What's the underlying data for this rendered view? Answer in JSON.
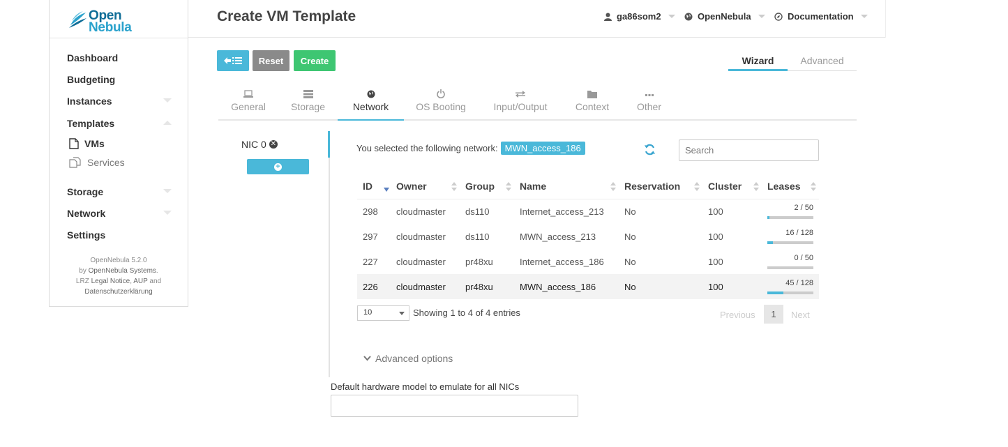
{
  "brand": {
    "line1": "Open",
    "line2": "Nebula"
  },
  "sidebar": {
    "items": [
      {
        "label": "Dashboard"
      },
      {
        "label": "Budgeting"
      },
      {
        "label": "Instances"
      },
      {
        "label": "Templates"
      },
      {
        "label": "Storage"
      },
      {
        "label": "Network"
      },
      {
        "label": "Settings"
      }
    ],
    "templates_sub": [
      {
        "label": "VMs"
      },
      {
        "label": "Services"
      }
    ],
    "footer": {
      "version": "OpenNebula 5.2.0",
      "by": "by",
      "company": "OpenNebula Systems",
      "lrz": "LRZ",
      "legal": "Legal Notice",
      "aup": "AUP",
      "and": "and",
      "privacy": "Datenschutzerklärung"
    }
  },
  "header": {
    "title": "Create VM Template",
    "user": "ga86som2",
    "zone": "OpenNebula",
    "docs": "Documentation"
  },
  "toolbar": {
    "reset": "Reset",
    "create": "Create"
  },
  "modes": {
    "wizard": "Wizard",
    "advanced": "Advanced"
  },
  "tabs": [
    {
      "label": "General",
      "icon": "laptop-icon"
    },
    {
      "label": "Storage",
      "icon": "server-icon"
    },
    {
      "label": "Network",
      "icon": "globe-icon"
    },
    {
      "label": "OS Booting",
      "icon": "power-icon"
    },
    {
      "label": "Input/Output",
      "icon": "exchange-icon"
    },
    {
      "label": "Context",
      "icon": "folder-icon"
    },
    {
      "label": "Other",
      "icon": "ellipsis-icon"
    }
  ],
  "nic": {
    "label": "NIC 0"
  },
  "network": {
    "selected_text": "You selected the following network:",
    "selected_value": "MWN_access_186",
    "search_placeholder": "Search",
    "columns": [
      "ID",
      "Owner",
      "Group",
      "Name",
      "Reservation",
      "Cluster",
      "Leases"
    ],
    "rows": [
      {
        "id": "298",
        "owner": "cloudmaster",
        "group": "ds110",
        "name": "Internet_access_213",
        "reservation": "No",
        "cluster": "100",
        "leases": "2 / 50",
        "used": 2,
        "total": 50
      },
      {
        "id": "297",
        "owner": "cloudmaster",
        "group": "ds110",
        "name": "MWN_access_213",
        "reservation": "No",
        "cluster": "100",
        "leases": "16 / 128",
        "used": 16,
        "total": 128
      },
      {
        "id": "227",
        "owner": "cloudmaster",
        "group": "pr48xu",
        "name": "Internet_access_186",
        "reservation": "No",
        "cluster": "100",
        "leases": "0 / 50",
        "used": 0,
        "total": 50
      },
      {
        "id": "226",
        "owner": "cloudmaster",
        "group": "pr48xu",
        "name": "MWN_access_186",
        "reservation": "No",
        "cluster": "100",
        "leases": "45 / 128",
        "used": 45,
        "total": 128
      }
    ],
    "page_length": "10",
    "showing": "Showing 1 to 4 of 4 entries",
    "prev": "Previous",
    "page": "1",
    "next": "Next",
    "advanced_options": "Advanced options"
  },
  "hw_model": {
    "label": "Default hardware model to emulate for all NICs",
    "value": ""
  },
  "colors": {
    "accent": "#4ab8d9",
    "create": "#3ec672",
    "reset": "#8a8a8a"
  }
}
